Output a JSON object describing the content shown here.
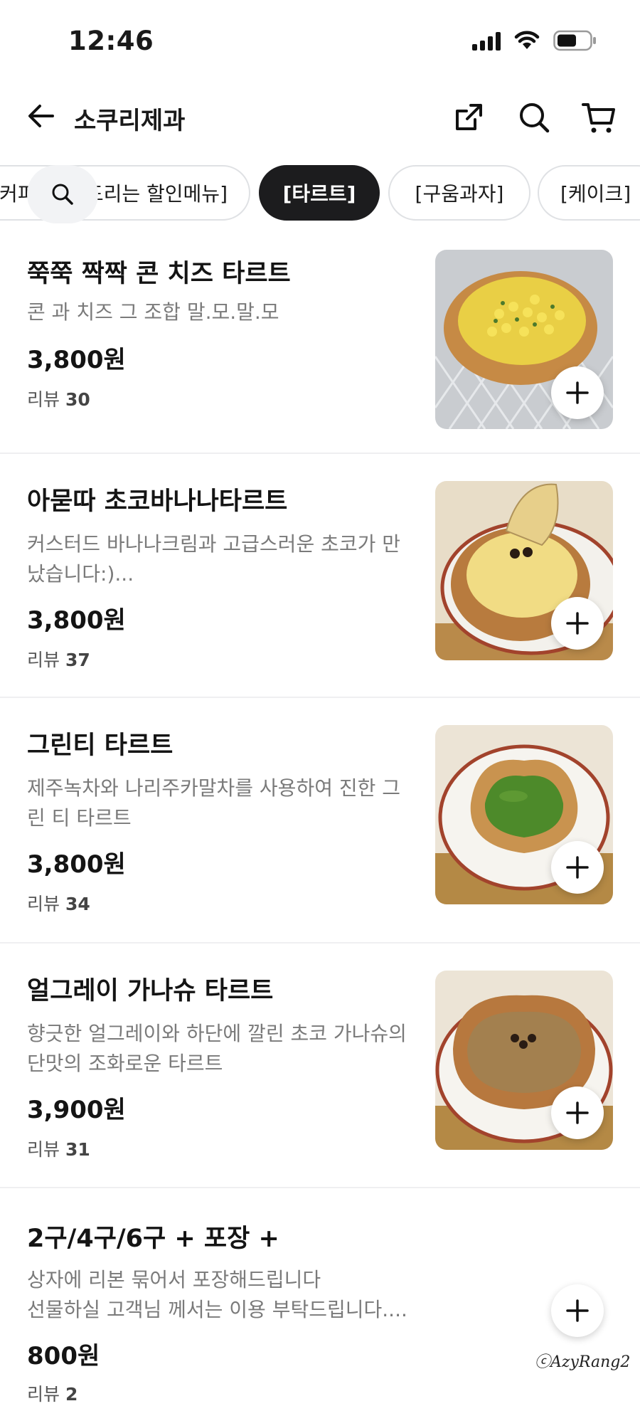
{
  "status": {
    "time": "12:46"
  },
  "header": {
    "title": "소쿠리제과"
  },
  "categories": {
    "chips": [
      "[오늘만! 커피 사면 드리는 할인메뉴]",
      "[타르트]",
      "[구움과자]",
      "[케이크]"
    ],
    "active": "[타르트]"
  },
  "menu": [
    {
      "name": "쭉쭉 짝짝 콘 치즈 타르트",
      "desc": "콘 과 치즈 그 조합 말.모.말.모",
      "price": "3,800원",
      "review_label": "리뷰",
      "review_count": "30"
    },
    {
      "name": "아묻따 초코바나나타르트",
      "desc": "커스터드 바나나크림과 고급스러운 초코가 만났습니다:)...",
      "price": "3,800원",
      "review_label": "리뷰",
      "review_count": "37"
    },
    {
      "name": "그린티 타르트",
      "desc": "제주녹차와 나리주카말차를 사용하여 진한 그린 티 타르트",
      "price": "3,800원",
      "review_label": "리뷰",
      "review_count": "34"
    },
    {
      "name": "얼그레이 가나슈 타르트",
      "desc": "향긋한 얼그레이와 하단에 깔린 초코 가나슈의 단맛의 조화로운 타르트",
      "price": "3,900원",
      "review_label": "리뷰",
      "review_count": "31"
    },
    {
      "name": "2구/4구/6구 + 포장 +",
      "desc_lines": [
        "상자에 리본 묶어서 포장해드립니다",
        "선물하실 고객님 께서는 이용 부탁드립니다...."
      ],
      "price": "800원",
      "review_label": "리뷰",
      "review_count": "2"
    }
  ],
  "watermark": "ⓒAzyRang2",
  "colors": {
    "active_chip": "#1c1c1e",
    "divider": "#efeff1",
    "muted_text": "#7a7a7a"
  }
}
